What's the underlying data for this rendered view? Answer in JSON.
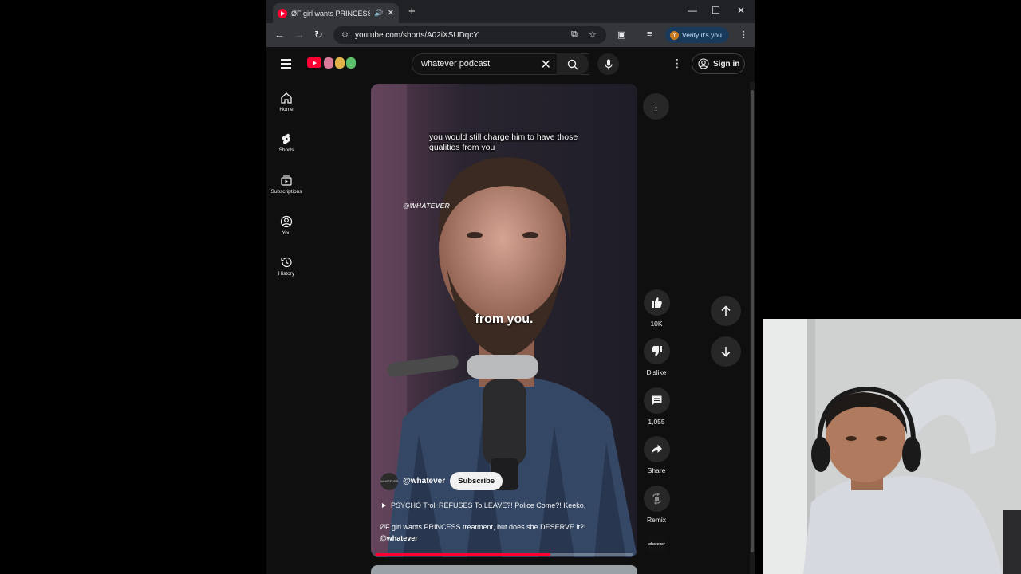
{
  "browser": {
    "tab_title": "ØF girl wants PRINCESS treatment",
    "url": "youtube.com/shorts/A02iXSUDqcY",
    "verify_label": "Verify it's you",
    "verify_initial": "Y"
  },
  "header": {
    "search_query": "whatever podcast",
    "signin_label": "Sign in"
  },
  "guide": {
    "items": [
      {
        "label": "Home"
      },
      {
        "label": "Shorts"
      },
      {
        "label": "Subscriptions"
      },
      {
        "label": "You"
      },
      {
        "label": "History"
      }
    ]
  },
  "video": {
    "caption_top": "you would still charge him to have those qualities from you",
    "watermark": "@WHATEVER",
    "caption_main": "from you.",
    "channel_handle": "@whatever",
    "channel_avatar_text": "WHATEVER",
    "subscribe_label": "Subscribe",
    "related_title": "PSYCHO Troll REFUSES To LEAVE?! Police Come?! Keeko,",
    "description": "ØF girl wants PRINCESS treatment, but does she DESERVE it?!",
    "description_handle": "@whatever",
    "progress_fraction": 0.68
  },
  "actions": {
    "like_count": "10K",
    "dislike_label": "Dislike",
    "comment_count": "1,055",
    "share_label": "Share",
    "remix_label": "Remix",
    "channel_thumb_text": "whatever"
  },
  "colors": {
    "youtube_red": "#ff0033",
    "background": "#0f0f0f",
    "button_bg": "#272727"
  }
}
